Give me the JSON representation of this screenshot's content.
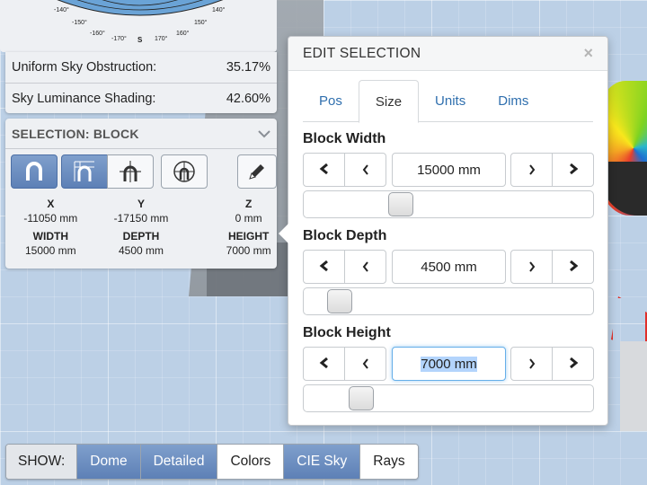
{
  "compass": {
    "ticks": [
      "-140°",
      "-150°",
      "-160°",
      "-170°",
      "S",
      "170°",
      "160°",
      "150°",
      "140°"
    ]
  },
  "stats": [
    {
      "label": "Uniform Sky Obstruction:",
      "value": "35.17%"
    },
    {
      "label": "Sky Luminance Shading:",
      "value": "42.60%"
    }
  ],
  "selection": {
    "title": "SELECTION: BLOCK",
    "coords": [
      {
        "label": "X",
        "value": "-11050 mm"
      },
      {
        "label": "Y",
        "value": "-17150 mm"
      },
      {
        "label": "Z",
        "value": "0 mm"
      }
    ],
    "dims": [
      {
        "label": "WIDTH",
        "value": "15000 mm"
      },
      {
        "label": "DEPTH",
        "value": "4500 mm"
      },
      {
        "label": "HEIGHT",
        "value": "7000 mm"
      }
    ],
    "tools": [
      "magnet-icon",
      "snap-grid-icon",
      "snap-object-icon",
      "globe-icon",
      "pencil-icon"
    ]
  },
  "edit": {
    "title": "EDIT SELECTION",
    "close": "×",
    "tabs": [
      {
        "label": "Pos",
        "active": false
      },
      {
        "label": "Size",
        "active": true
      },
      {
        "label": "Units",
        "active": false
      },
      {
        "label": "Dims",
        "active": false
      }
    ],
    "fields": [
      {
        "label": "Block Width",
        "value": "15000 mm",
        "slider": 0.32
      },
      {
        "label": "Block Depth",
        "value": "4500 mm",
        "slider": 0.09
      },
      {
        "label": "Block Height",
        "value": "7000 mm",
        "slider": 0.17
      }
    ],
    "buttons": {
      "fast_left": "«",
      "left": "‹",
      "right": "›",
      "fast_right": "»"
    }
  },
  "show": {
    "label": "SHOW:",
    "items": [
      {
        "label": "Dome",
        "active": true
      },
      {
        "label": "Detailed",
        "active": true
      },
      {
        "label": "Colors",
        "active": false
      },
      {
        "label": "CIE Sky",
        "active": true
      },
      {
        "label": "Rays",
        "active": false
      }
    ]
  }
}
